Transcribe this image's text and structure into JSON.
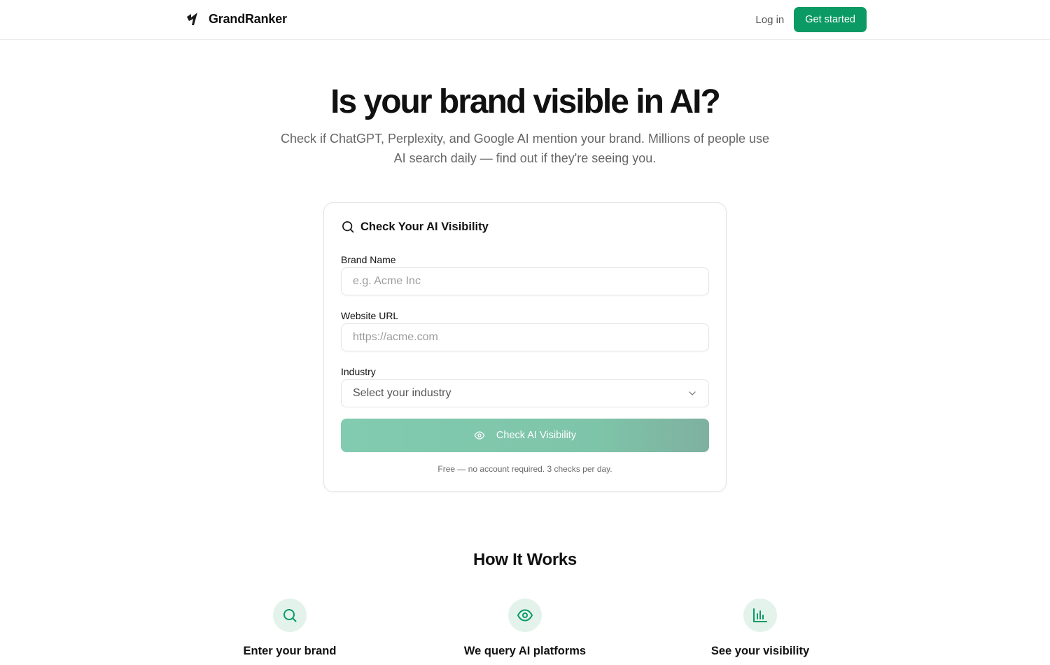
{
  "header": {
    "brand_name": "GrandRanker",
    "login_label": "Log in",
    "cta_label": "Get started"
  },
  "hero": {
    "title": "Is your brand visible in AI?",
    "subtitle": "Check if ChatGPT, Perplexity, and Google AI mention your brand. Millions of people use AI search daily — find out if they're seeing you."
  },
  "form": {
    "title": "Check Your AI Visibility",
    "brand_label": "Brand Name",
    "brand_placeholder": "e.g. Acme Inc",
    "url_label": "Website URL",
    "url_placeholder": "https://acme.com",
    "industry_label": "Industry",
    "industry_value": "Select your industry",
    "submit_label": "Check AI Visibility",
    "note": "Free — no account required. 3 checks per day."
  },
  "how_it_works": {
    "title": "How It Works",
    "steps": [
      {
        "title": "Enter your brand",
        "icon": "search-icon"
      },
      {
        "title": "We query AI platforms",
        "icon": "eye-icon"
      },
      {
        "title": "See your visibility",
        "icon": "bar-chart-icon"
      }
    ]
  },
  "colors": {
    "accent": "#0b9a63",
    "accent_soft": "#e3f3ec",
    "button_disabled": "#82cbb0"
  }
}
